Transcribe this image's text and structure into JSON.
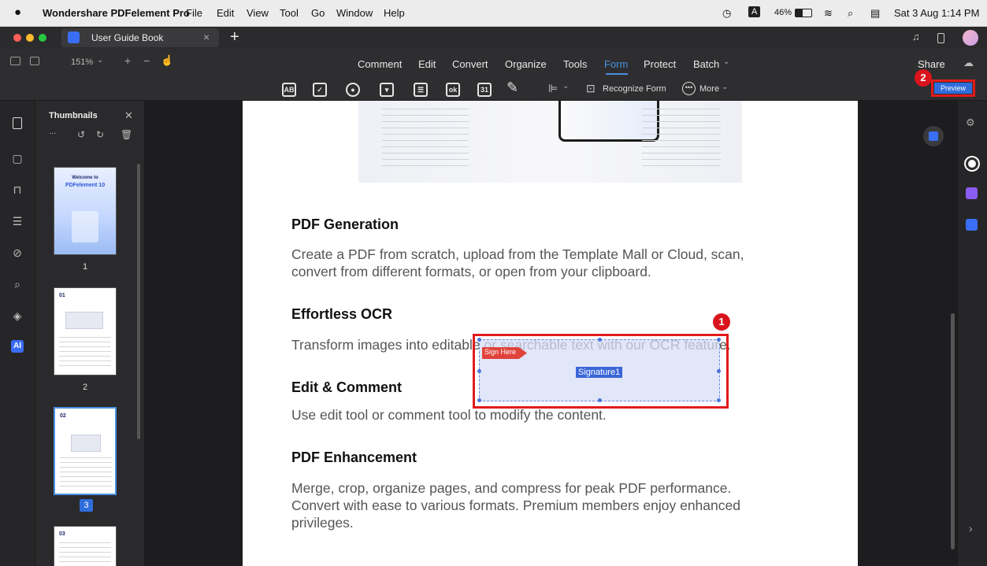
{
  "menubar": {
    "app_name": "Wondershare PDFelement Pro",
    "items": [
      "File",
      "Edit",
      "View",
      "Tool",
      "Go",
      "Window",
      "Help"
    ],
    "battery": "46%",
    "datetime": "Sat 3 Aug  1:14 PM",
    "input_badge": "A"
  },
  "tabbar": {
    "tab_title": "User Guide Book",
    "close": "×",
    "add": "+"
  },
  "toolbar": {
    "zoom": "151%",
    "zoom_in": "+",
    "zoom_out": "−",
    "menu": [
      "Comment",
      "Edit",
      "Convert",
      "Organize",
      "Tools",
      "Form",
      "Protect",
      "Batch"
    ],
    "active_menu": "Form",
    "share_label": "Share",
    "preview_label": "Preview",
    "recognize_label": "Recognize Form",
    "more_label": "More",
    "form_icons": [
      "AB",
      "✓",
      "●",
      "▾",
      "☰",
      "ok",
      "31"
    ],
    "accent": "#4a90e2"
  },
  "thumbnails": {
    "title": "Thumbnails",
    "ellipsis": "...",
    "pages": [
      {
        "label": "1",
        "heading": "Welcome to",
        "subheading": "PDFelement 10"
      },
      {
        "label": "2",
        "heading": "01"
      },
      {
        "label": "3",
        "heading": "02"
      },
      {
        "label": "",
        "heading": "03"
      }
    ],
    "selected": "3"
  },
  "document": {
    "sections": [
      {
        "title": "PDF Generation",
        "body": "Create a PDF from scratch, upload from the Template Mall or Cloud, scan,\nconvert from different formats, or open from your clipboard."
      },
      {
        "title": "Effortless OCR",
        "body": "Transform images into editable or searchable text with our OCR feature."
      },
      {
        "title": "Edit & Comment",
        "body": "Use edit tool or comment tool to modify the content."
      },
      {
        "title": "PDF Enhancement",
        "body": "Merge, crop, organize pages, and compress for peak PDF performance.\nConvert with ease to various formats. Premium members enjoy enhanced\nprivileges."
      }
    ],
    "signature_field": {
      "tag": "Sign Here",
      "name": "Signature1"
    }
  },
  "annotations": {
    "badge1": "1",
    "badge2": "2",
    "highlight_color": "#e21b1b"
  },
  "rightrail": {
    "ai_label": "AI",
    "arrow": "›"
  }
}
